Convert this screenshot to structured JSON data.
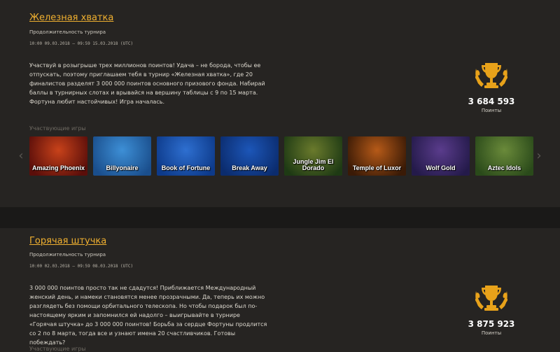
{
  "tournaments": [
    {
      "title": "Железная хватка",
      "duration_label": "Продолжительность турнира",
      "dates": "10:00 09.03.2018 — 09:59 15.03.2018 (UTC)",
      "description": "Участвуй в розыгрыше трех миллионов поинтов! Удача – не борода, чтобы ее отпускать, поэтому приглашаем тебя в турнир «Железная хватка», где 20 финалистов разделят 3 000 000 поинтов основного призового фонда. Набирай баллы в турнирных слотах и врывайся на вершину таблицы с 9 по 15 марта. Фортуна любит настойчивых! Игра началась.",
      "points_value": "3 684 593",
      "points_label": "Поинты",
      "games_label": "Участвующие игры",
      "games": [
        {
          "name": "Amazing Phoenix",
          "colors": [
            "#5a0e0a",
            "#c8421a"
          ]
        },
        {
          "name": "Billyonaire",
          "colors": [
            "#1a4e8c",
            "#3d8fd6"
          ]
        },
        {
          "name": "Book of Fortune",
          "colors": [
            "#0d3a8a",
            "#2e6fd0"
          ]
        },
        {
          "name": "Break Away",
          "colors": [
            "#0b2c6e",
            "#1c56b8"
          ]
        },
        {
          "name": "Jungle Jim El Dorado",
          "colors": [
            "#1e3a14",
            "#6a7a2c"
          ]
        },
        {
          "name": "Temple of Luxor",
          "colors": [
            "#3a1a06",
            "#b65a18"
          ]
        },
        {
          "name": "Wolf Gold",
          "colors": [
            "#241a4a",
            "#5a3c8c"
          ]
        },
        {
          "name": "Aztec Idols",
          "colors": [
            "#2a4a1a",
            "#6a8a3a"
          ]
        }
      ]
    },
    {
      "title": "Горячая штучка",
      "duration_label": "Продолжительность турнира",
      "dates": "10:00 02.03.2018 — 09:59 08.03.2018 (UTC)",
      "description": "3 000 000 поинтов просто так не сдадутся! Приближается Международный женский день, и намеки становятся менее прозрачными. Да, теперь их можно разглядеть без помощи орбитального телескопа. Но чтобы подарок был по-настоящему ярким и запомнился ей надолго – выигрывайте в турнире «Горячая штучка» до 3 000 000 поинтов! Борьба за сердце Фортуны продлится со 2 по 8 марта, тогда все и узнают имена 20 счастливчиков. Готовы побеждать?",
      "points_value": "3 875 923",
      "points_label": "Поинты",
      "games_label": "Участвующие игры"
    }
  ],
  "icons": {
    "trophy": "trophy-icon",
    "carousel_prev": "chevron-left-icon",
    "carousel_next": "chevron-right-icon"
  },
  "colors": {
    "accent": "#f0b030",
    "background": "#262422",
    "divider": "#1a1918"
  }
}
